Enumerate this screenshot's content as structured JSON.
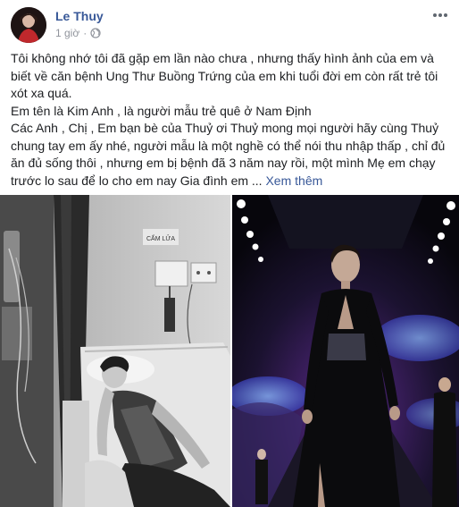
{
  "post": {
    "author": "Le Thuy",
    "time": "1 giờ",
    "separator": "·",
    "paragraphs": [
      "Tôi không nhớ tôi đã gặp em lần nào chưa , nhưng thấy hình ảnh của em và biết về căn bệnh Ung Thư Buồng Trứng của em khi tuổi đời em còn rất trẻ tôi xót xa quá.",
      "Em tên là Kim Anh , là người mẫu trẻ quê ở Nam Định",
      "Các Anh , Chị , Em bạn bè của Thuỷ ơi Thuỷ mong mọi người hãy cùng Thuỷ chung tay em ấy nhé, người mẫu là một nghề có thể nói thu nhập thấp , chỉ đủ ăn đủ sống thôi , nhưng em bị bệnh đã 3 năm nay rồi, một mình Mẹ em chạy trước lo sau để lo cho em nay Gia đình em ..."
    ],
    "see_more": "Xem thêm",
    "icons": {
      "privacy": "globe-icon",
      "menu": "more-horizontal-icon"
    }
  },
  "photos": {
    "left_sign": "CẤM LỬA"
  },
  "colors": {
    "author": "#385898",
    "meta": "#90949c",
    "text": "#1c1e21"
  }
}
